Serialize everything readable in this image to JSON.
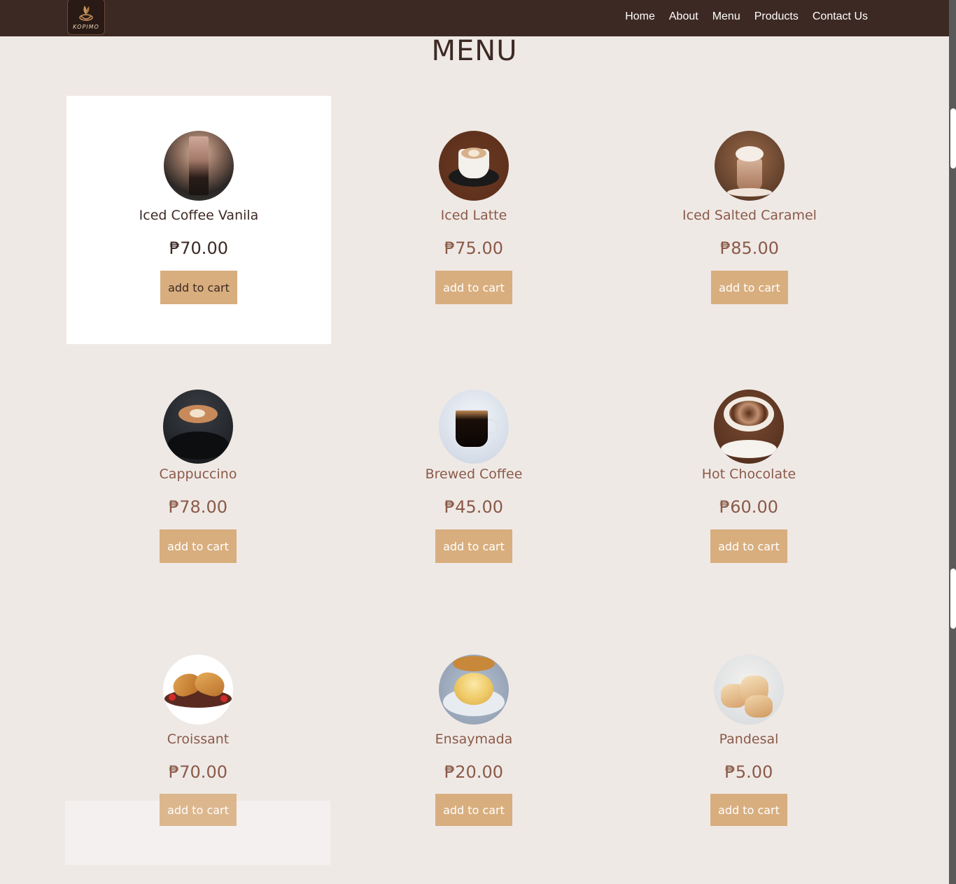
{
  "header": {
    "logo_text": "KOPIMO",
    "nav": [
      "Home",
      "About",
      "Menu",
      "Products",
      "Contact Us"
    ]
  },
  "page_title": "MENU",
  "colors": {
    "header_bg": "#3d2923",
    "page_bg": "#efe9e6",
    "button_bg": "#d8ae7e",
    "text_brown": "#8a5a48"
  },
  "products": [
    {
      "name": "Iced Coffee Vanila",
      "price": "₱70.00",
      "button": "add to cart",
      "icon": "iced-coffee-icon"
    },
    {
      "name": "Iced Latte",
      "price": "₱75.00",
      "button": "add to cart",
      "icon": "latte-icon"
    },
    {
      "name": "Iced Salted Caramel",
      "price": "₱85.00",
      "button": "add to cart",
      "icon": "caramel-drink-icon"
    },
    {
      "name": "Cappuccino",
      "price": "₱78.00",
      "button": "add to cart",
      "icon": "cappuccino-icon"
    },
    {
      "name": "Brewed Coffee",
      "price": "₱45.00",
      "button": "add to cart",
      "icon": "brewed-coffee-icon"
    },
    {
      "name": "Hot Chocolate",
      "price": "₱60.00",
      "button": "add to cart",
      "icon": "hot-chocolate-icon"
    },
    {
      "name": "Croissant",
      "price": "₱70.00",
      "button": "add to cart",
      "icon": "croissant-icon"
    },
    {
      "name": "Ensaymada",
      "price": "₱20.00",
      "button": "add to cart",
      "icon": "ensaymada-icon"
    },
    {
      "name": "Pandesal",
      "price": "₱5.00",
      "button": "add to cart",
      "icon": "pandesal-icon"
    }
  ]
}
